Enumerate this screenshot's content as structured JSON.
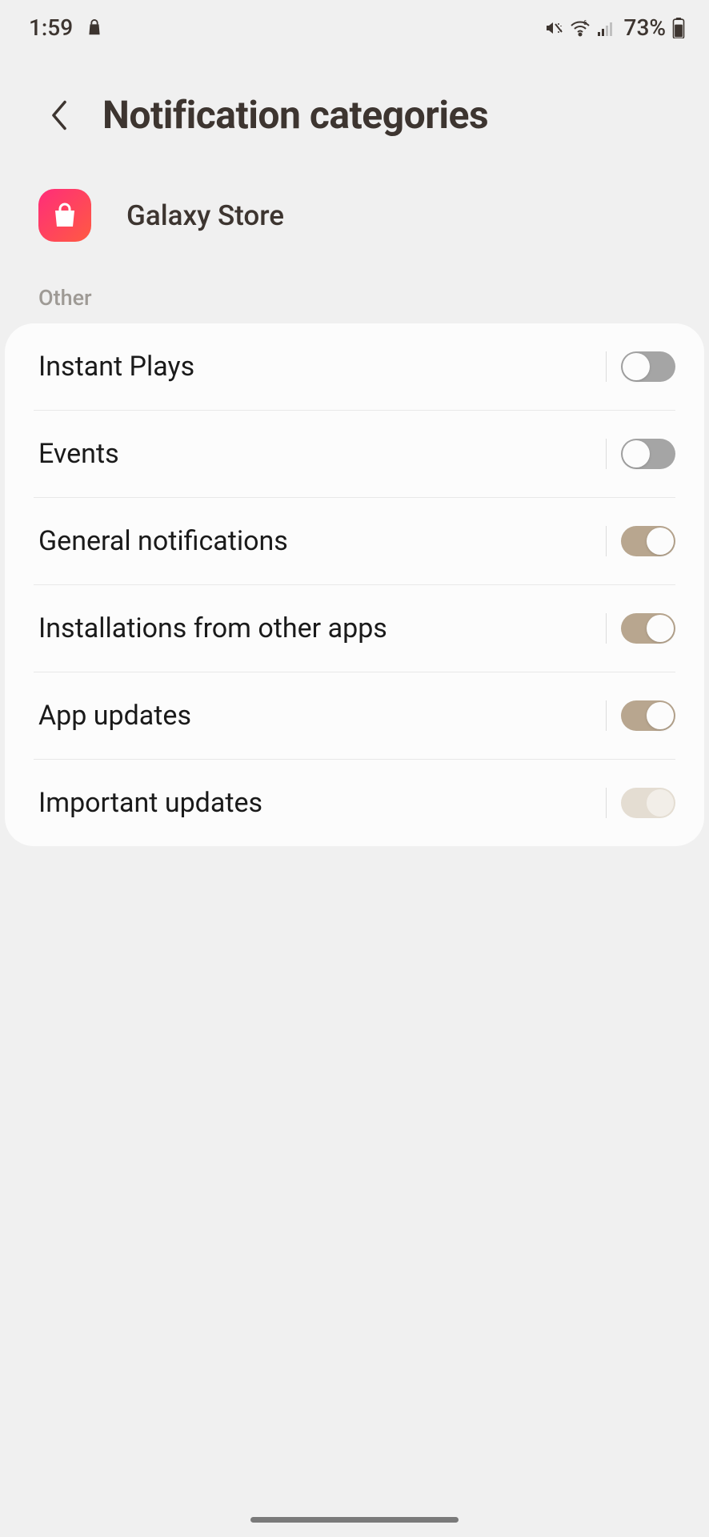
{
  "statusBar": {
    "time": "1:59",
    "batteryPct": "73%"
  },
  "header": {
    "title": "Notification categories"
  },
  "app": {
    "name": "Galaxy Store"
  },
  "section": {
    "label": "Other"
  },
  "rows": [
    {
      "label": "Instant Plays",
      "state": "off"
    },
    {
      "label": "Events",
      "state": "off"
    },
    {
      "label": "General notifications",
      "state": "on"
    },
    {
      "label": "Installations from other apps",
      "state": "on"
    },
    {
      "label": "App updates",
      "state": "on"
    },
    {
      "label": "Important updates",
      "state": "disabled-on"
    }
  ]
}
